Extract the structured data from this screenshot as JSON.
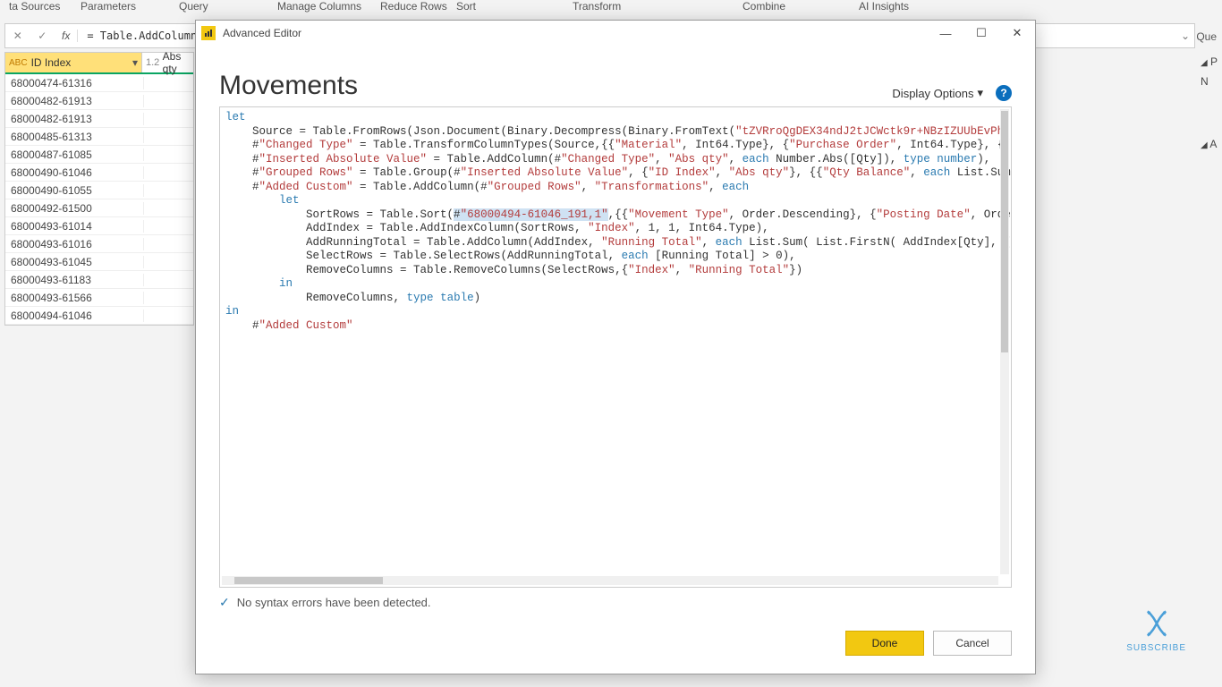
{
  "ribbon": {
    "sources": "ta Sources",
    "parameters": "Parameters",
    "query": "Query",
    "manage": "Manage Columns",
    "reduce": "Reduce Rows",
    "sort": "Sort",
    "transform": "Transform",
    "combine": "Combine",
    "ai": "AI Insights"
  },
  "formula_bar": {
    "fx": "fx",
    "text": "= Table.AddColumn(#"
  },
  "right_label": "Que",
  "table": {
    "col1_label": "ID Index",
    "col2_type": "1.2",
    "col2_label": "Abs qty",
    "rows": [
      "68000474-61316",
      "68000482-61913",
      "68000482-61913",
      "68000485-61313",
      "68000487-61085",
      "68000490-61046",
      "68000490-61055",
      "68000492-61500",
      "68000493-61014",
      "68000493-61016",
      "68000493-61045",
      "68000493-61183",
      "68000493-61566",
      "68000494-61046"
    ]
  },
  "right_panel": {
    "p": "P",
    "n": "N",
    "a": "A"
  },
  "dialog": {
    "title": "Advanced Editor",
    "heading": "Movements",
    "display_options": "Display Options",
    "status": "No syntax errors have been detected.",
    "done": "Done",
    "cancel": "Cancel"
  },
  "subscribe": "SUBSCRIBE"
}
